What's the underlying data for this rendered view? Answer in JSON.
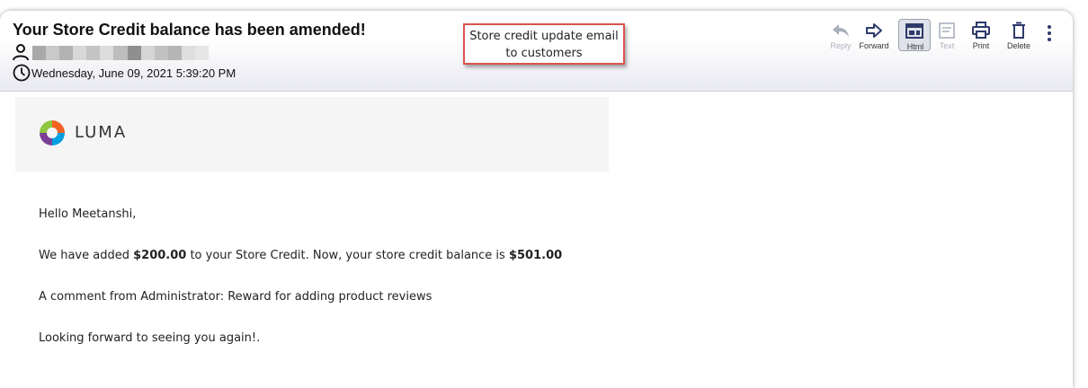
{
  "email": {
    "subject": "Your Store Credit balance has been amended!",
    "date": "Wednesday, June 09, 2021 5:39:20 PM"
  },
  "callout": {
    "line1": "Store credit update email",
    "line2": "to customers"
  },
  "toolbar": {
    "reply": "Reply",
    "forward": "Forward",
    "html": "Html",
    "text": "Text",
    "print": "Print",
    "delete": "Delete"
  },
  "brand": {
    "name": "LUMA"
  },
  "message": {
    "greeting": "Hello Meetanshi,",
    "line1_prefix": "We have added ",
    "line1_amount": "$200.00",
    "line1_middle": " to your Store Credit. Now, your store credit balance is ",
    "line1_balance": "$501.00",
    "comment": "A comment from Administrator: Reward for adding product reviews",
    "closing": "Looking forward to seeing you again!."
  },
  "colors": {
    "accent_red": "#d9534f",
    "icon_blue": "#2d3a6b",
    "redacted_tones": [
      "#a9a9a9",
      "#c9c9c9",
      "#b3b3b3",
      "#d8d8d8",
      "#c4c4c4",
      "#dcdcdc",
      "#bdbdbd",
      "#8f8f8f",
      "#d5d5d5",
      "#c1c1c1",
      "#b5b5b5",
      "#dedede",
      "#e6e6e6"
    ]
  }
}
